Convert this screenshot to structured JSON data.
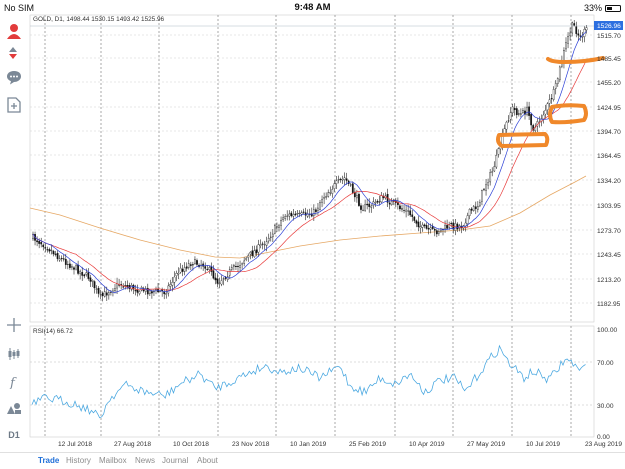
{
  "status_bar": {
    "carrier": "No SIM",
    "time": "9:48 AM",
    "battery": "33%",
    "battery_level": 0.33
  },
  "chart": {
    "header": "GOLD, D1, 1498.44 1530.15 1493.42 1525.96",
    "current_price": "1526.96",
    "price_ticks": [
      "1515.70",
      "1485.45",
      "1455.20",
      "1424.95",
      "1394.70",
      "1364.45",
      "1334.20",
      "1303.95",
      "1273.70",
      "1243.45",
      "1213.20",
      "1182.95"
    ],
    "date_ticks": [
      "12 Jul 2018",
      "27 Aug 2018",
      "10 Oct 2018",
      "23 Nov 2018",
      "10 Jan 2019",
      "25 Feb 2019",
      "10 Apr 2019",
      "27 May 2019",
      "10 Jul 2019",
      "23 Aug 2019"
    ],
    "indicator_label": "RSI(14) 66.72",
    "rsi_ticks": [
      "100.00",
      "70.00",
      "30.00",
      "0.00"
    ]
  },
  "tabs": [
    {
      "label": "Trade",
      "active": true
    },
    {
      "label": "History",
      "active": false
    },
    {
      "label": "Mailbox",
      "active": false
    },
    {
      "label": "News",
      "active": false
    },
    {
      "label": "Journal",
      "active": false
    },
    {
      "label": "About",
      "active": false
    }
  ],
  "toolbar": {
    "timeframe_label": "D1"
  },
  "colors": {
    "accent": "#1f6fd8",
    "ma_fast": "#2b3fd6",
    "ma_mid": "#e83b3b",
    "ma_slow": "#e6a865",
    "rsi": "#46a6e0",
    "marker": "#f0882a"
  }
}
